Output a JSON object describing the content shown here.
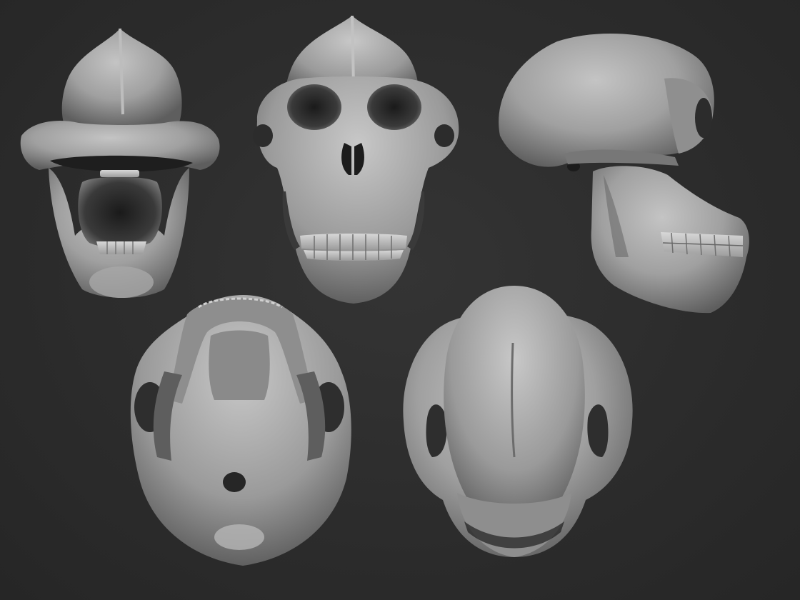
{
  "scene": {
    "background_color": "#2c2c2c",
    "sculpt_color": "#a6a6a6",
    "views": [
      {
        "id": "skull-view-front-open-jaw",
        "description_icon": "skull-front-open-jaw"
      },
      {
        "id": "skull-view-front",
        "description_icon": "skull-front"
      },
      {
        "id": "skull-view-side",
        "description_icon": "skull-side"
      },
      {
        "id": "skull-view-bottom",
        "description_icon": "skull-bottom"
      },
      {
        "id": "skull-view-top",
        "description_icon": "skull-top"
      }
    ]
  }
}
